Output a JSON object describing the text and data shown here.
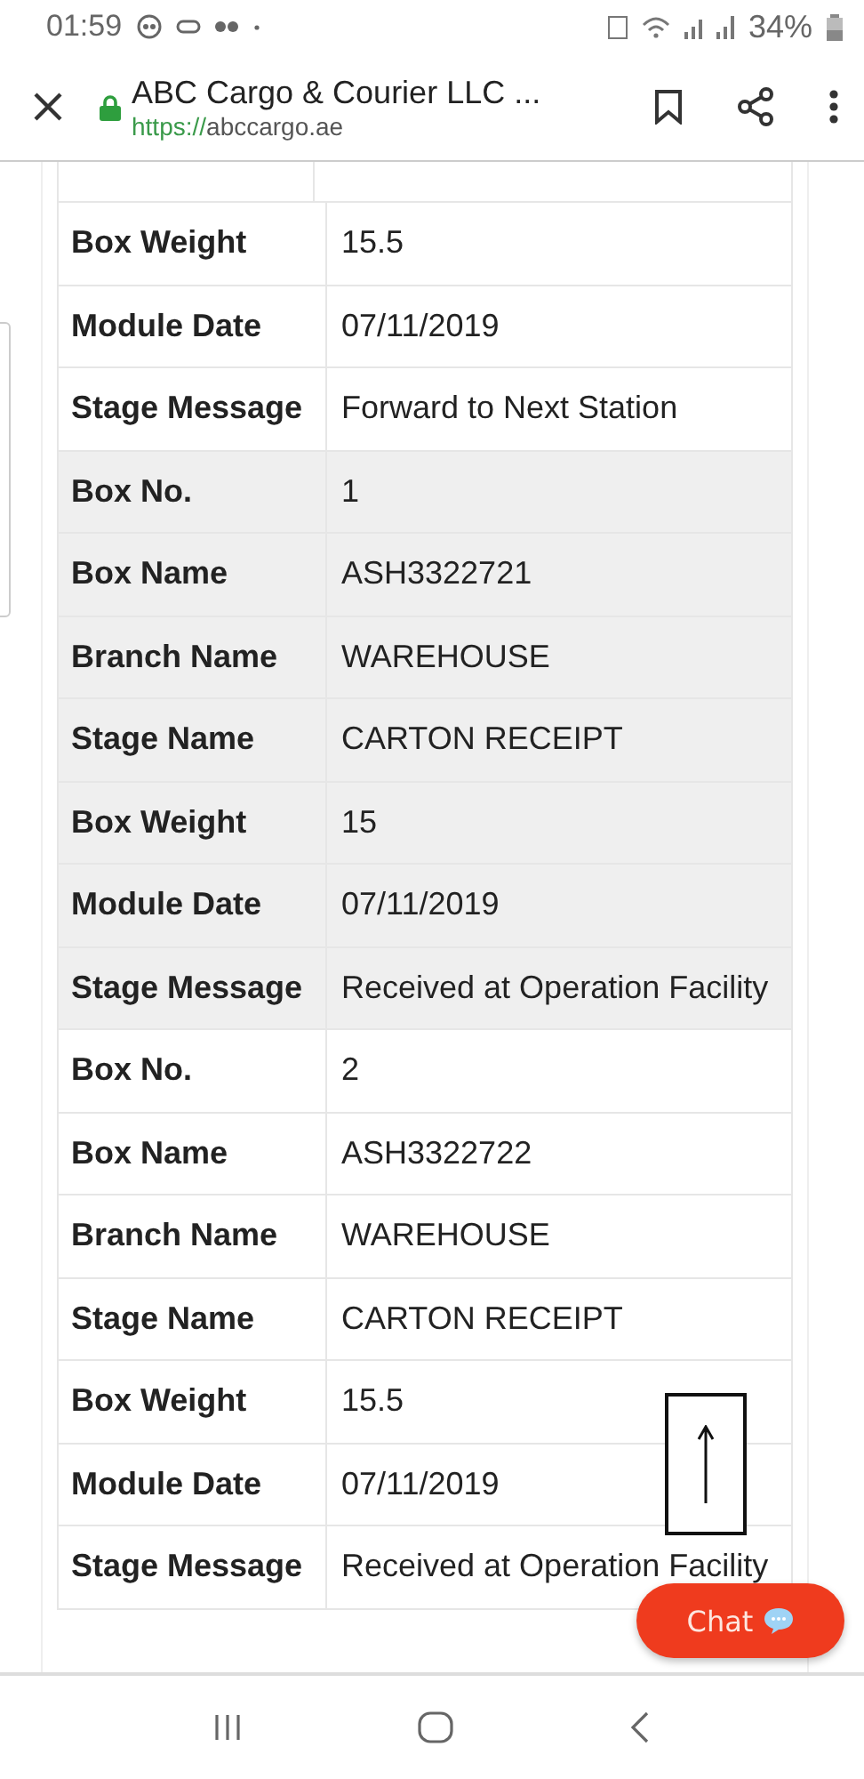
{
  "status_bar": {
    "time": "01:59",
    "battery": "34%"
  },
  "toolbar": {
    "title": "ABC Cargo & Courier LLC ...",
    "url_scheme": "https://",
    "url_host": "abccargo.ae"
  },
  "groups": [
    {
      "shaded": false,
      "rows": [
        {
          "label": "Box Weight",
          "value": "15.5"
        },
        {
          "label": "Module Date",
          "value": "07/11/2019"
        },
        {
          "label": "Stage Message",
          "value": "Forward to Next Station"
        }
      ]
    },
    {
      "shaded": true,
      "rows": [
        {
          "label": "Box No.",
          "value": "1"
        },
        {
          "label": "Box Name",
          "value": "ASH3322721"
        },
        {
          "label": "Branch Name",
          "value": "WAREHOUSE"
        },
        {
          "label": "Stage Name",
          "value": "CARTON RECEIPT"
        },
        {
          "label": "Box Weight",
          "value": "15"
        },
        {
          "label": "Module Date",
          "value": "07/11/2019"
        },
        {
          "label": "Stage Message",
          "value": "Received at Operation Facility"
        }
      ]
    },
    {
      "shaded": false,
      "rows": [
        {
          "label": "Box No.",
          "value": "2"
        },
        {
          "label": "Box Name",
          "value": "ASH3322722"
        },
        {
          "label": "Branch Name",
          "value": "WAREHOUSE"
        },
        {
          "label": "Stage Name",
          "value": "CARTON RECEIPT"
        },
        {
          "label": "Box Weight",
          "value": "15.5"
        },
        {
          "label": "Module Date",
          "value": "07/11/2019"
        },
        {
          "label": "Stage Message",
          "value": "Received at Operation Facility"
        }
      ]
    }
  ],
  "chat_button": {
    "label": "Chat"
  }
}
